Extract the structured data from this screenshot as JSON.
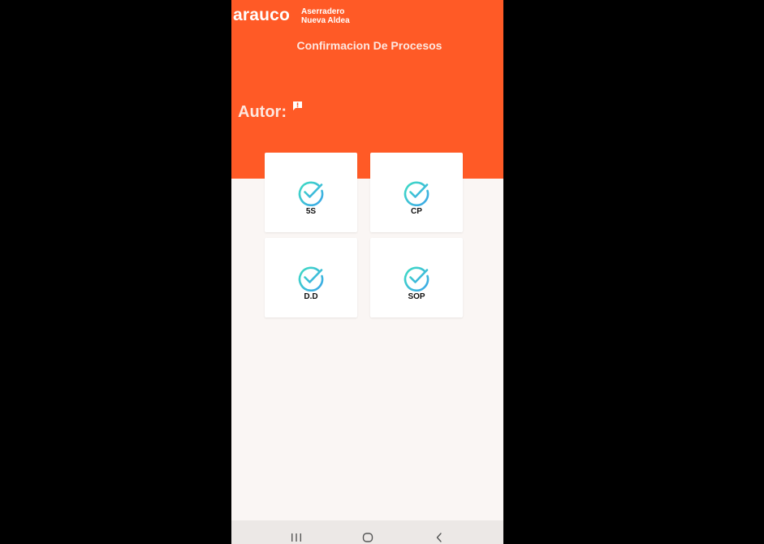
{
  "app": {
    "brand": "arauco",
    "plant_line1": "Aserradero",
    "plant_line2": "Nueva Aldea",
    "screen_title": "Confirmacion De Procesos"
  },
  "author": {
    "label": "Autor:",
    "value": "",
    "icon": "alert-feedback-icon"
  },
  "tiles": [
    {
      "label": "5S",
      "icon": "check-circle-icon"
    },
    {
      "label": "CP",
      "icon": "check-circle-icon"
    },
    {
      "label": "D.D",
      "icon": "check-circle-icon"
    },
    {
      "label": "SOP",
      "icon": "check-circle-icon"
    }
  ],
  "navbar": {
    "icons": [
      "recent-apps-icon",
      "home-icon",
      "back-icon"
    ]
  },
  "colors": {
    "header": "#ff5a26",
    "background": "#faf6f4",
    "check_gradient_start": "#3fdcc3",
    "check_gradient_end": "#3ba5e8"
  }
}
